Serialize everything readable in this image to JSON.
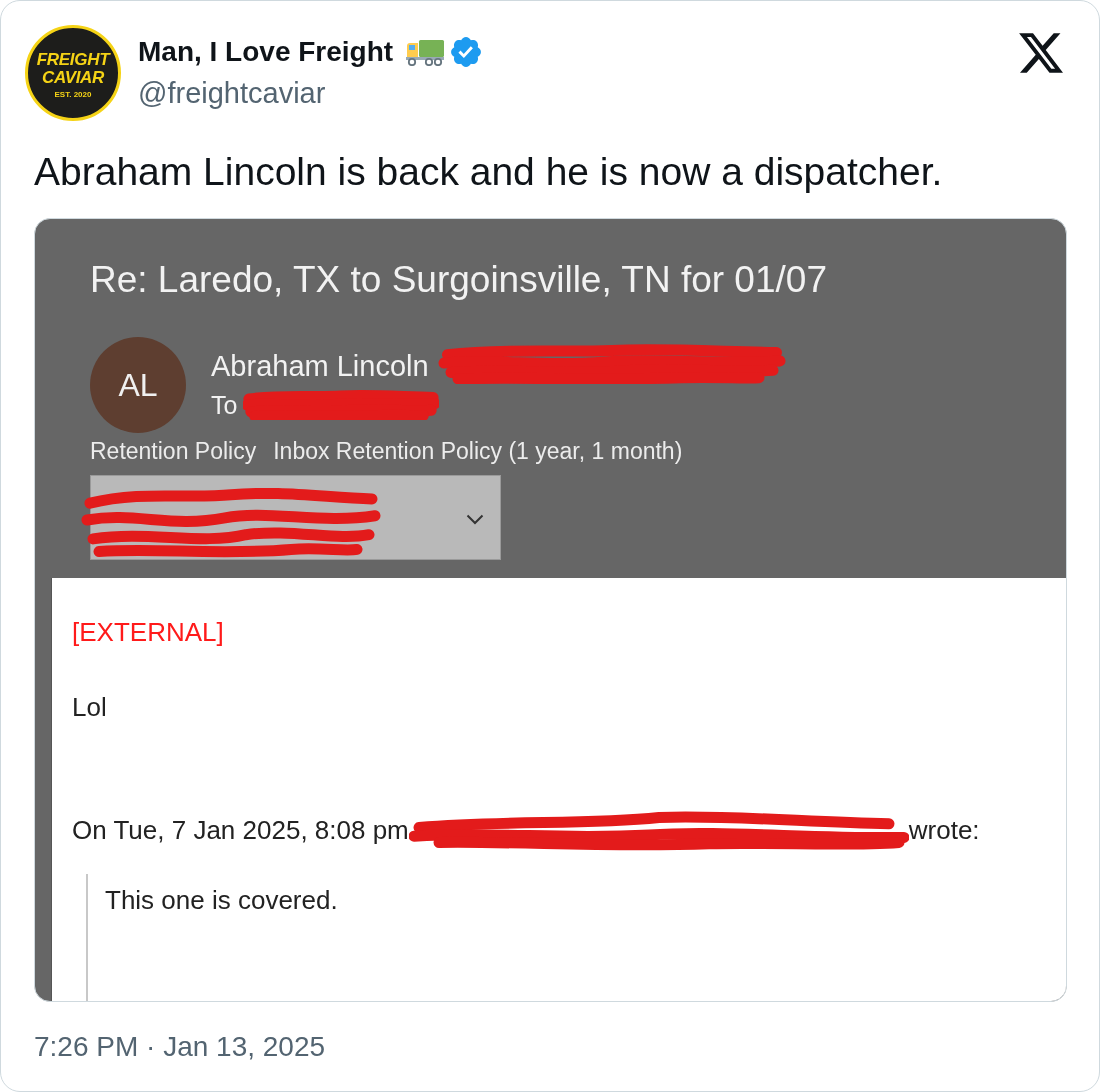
{
  "post": {
    "author": {
      "logo": {
        "line_1": "FREIGHT",
        "line_2": "CAVIAR",
        "tagline": "EST. 2020"
      },
      "name": "Man, I Love Freight",
      "verified": true,
      "handle": "@freightcaviar"
    },
    "text": "Abraham Lincoln is back and he is now a dispatcher.",
    "email": {
      "subject": "Re: Laredo, TX to Surgoinsville, TN for 01/07",
      "sender": {
        "initials": "AL",
        "name": "Abraham Lincoln",
        "to_label": "To"
      },
      "retention": {
        "label": "Retention Policy",
        "value": "Inbox Retention Policy (1 year, 1 month)"
      },
      "body": {
        "tag": "[EXTERNAL]",
        "greeting": "Lol",
        "quote_header": {
          "prefix": "On Tue, 7 Jan 2025, 8:08 pm",
          "suffix": "wrote:"
        },
        "quoted_text": "This one is covered."
      }
    },
    "timestamp": "7:26 PM · Jan 13, 2025"
  }
}
